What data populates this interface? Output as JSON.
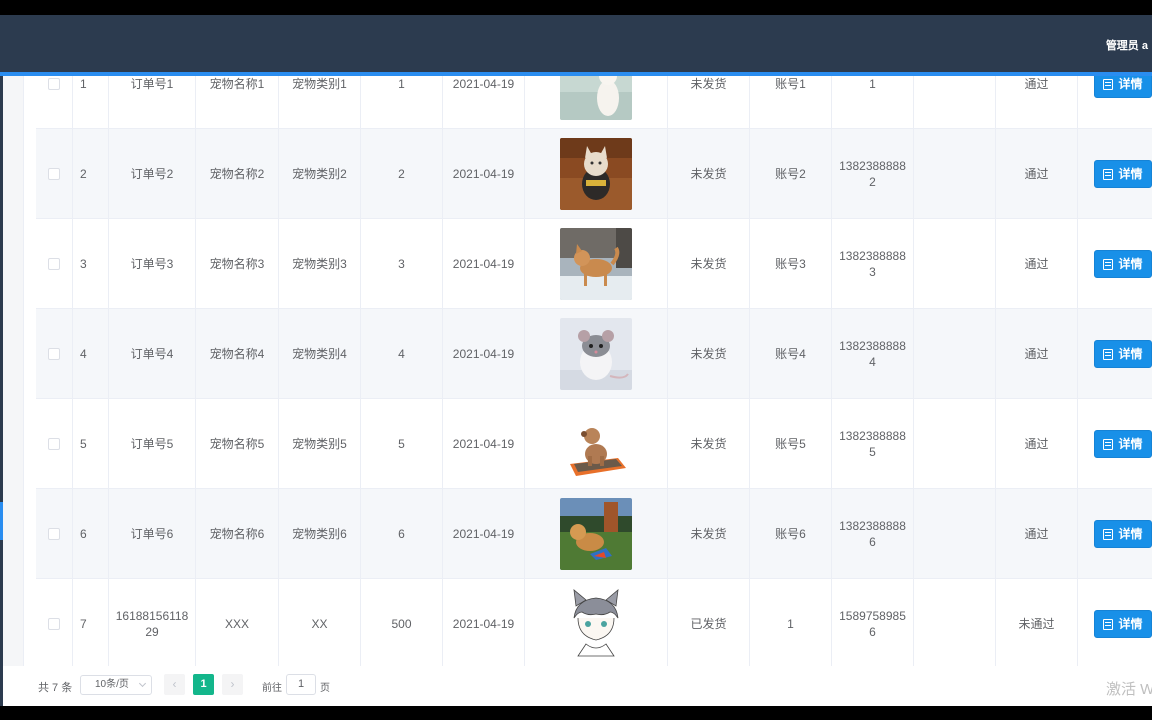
{
  "header": {
    "user_label": "管理员 a"
  },
  "rows": [
    {
      "index": "1",
      "order_no": "订单号1",
      "pet_name": "宠物名称1",
      "pet_category": "宠物类别1",
      "quantity": "1",
      "date": "2021-04-19",
      "image": "white-cat-photo",
      "ship_status": "未发货",
      "account": "账号1",
      "phone": "1",
      "remark": "",
      "review_status": "通过",
      "detail_label": "详情"
    },
    {
      "index": "2",
      "order_no": "订单号2",
      "pet_name": "宠物名称2",
      "pet_category": "宠物类别2",
      "quantity": "2",
      "date": "2021-04-19",
      "image": "costumed-cat-photo",
      "ship_status": "未发货",
      "account": "账号2",
      "phone": "13823888882",
      "remark": "",
      "review_status": "通过",
      "detail_label": "详情"
    },
    {
      "index": "3",
      "order_no": "订单号3",
      "pet_name": "宠物名称3",
      "pet_category": "宠物类别3",
      "quantity": "3",
      "date": "2021-04-19",
      "image": "shiba-dog-snow-photo",
      "ship_status": "未发货",
      "account": "账号3",
      "phone": "13823888883",
      "remark": "",
      "review_status": "通过",
      "detail_label": "详情"
    },
    {
      "index": "4",
      "order_no": "订单号4",
      "pet_name": "宠物名称4",
      "pet_category": "宠物类别4",
      "quantity": "4",
      "date": "2021-04-19",
      "image": "rat-photo",
      "ship_status": "未发货",
      "account": "账号4",
      "phone": "13823888884",
      "remark": "",
      "review_status": "通过",
      "detail_label": "详情"
    },
    {
      "index": "5",
      "order_no": "订单号5",
      "pet_name": "宠物名称5",
      "pet_category": "宠物类别5",
      "quantity": "5",
      "date": "2021-04-19",
      "image": "poodle-on-mat-photo",
      "ship_status": "未发货",
      "account": "账号5",
      "phone": "13823888885",
      "remark": "",
      "review_status": "通过",
      "detail_label": "详情"
    },
    {
      "index": "6",
      "order_no": "订单号6",
      "pet_name": "宠物名称6",
      "pet_category": "宠物类别6",
      "quantity": "6",
      "date": "2021-04-19",
      "image": "dog-on-grass-photo",
      "ship_status": "未发货",
      "account": "账号6",
      "phone": "13823888886",
      "remark": "",
      "review_status": "通过",
      "detail_label": "详情"
    },
    {
      "index": "7",
      "order_no": "1618815611829",
      "pet_name": "XXX",
      "pet_category": "XX",
      "quantity": "500",
      "date": "2021-04-19",
      "image": "anime-cat-boy-drawing",
      "ship_status": "已发货",
      "account": "1",
      "phone": "15897589856",
      "remark": "",
      "review_status": "未通过",
      "detail_label": "详情"
    }
  ],
  "pagination": {
    "total_text": "共 7 条",
    "page_size": "10条/页",
    "prev": "‹",
    "current_page": "1",
    "next": "›",
    "goto_label": "前往",
    "goto_value": "1",
    "page_unit": "页"
  },
  "watermark": "激活 W",
  "colors": {
    "header": "#2c3b4f",
    "accent": "#2a8df0",
    "button": "#1890e8",
    "active_page": "#13b68b"
  }
}
